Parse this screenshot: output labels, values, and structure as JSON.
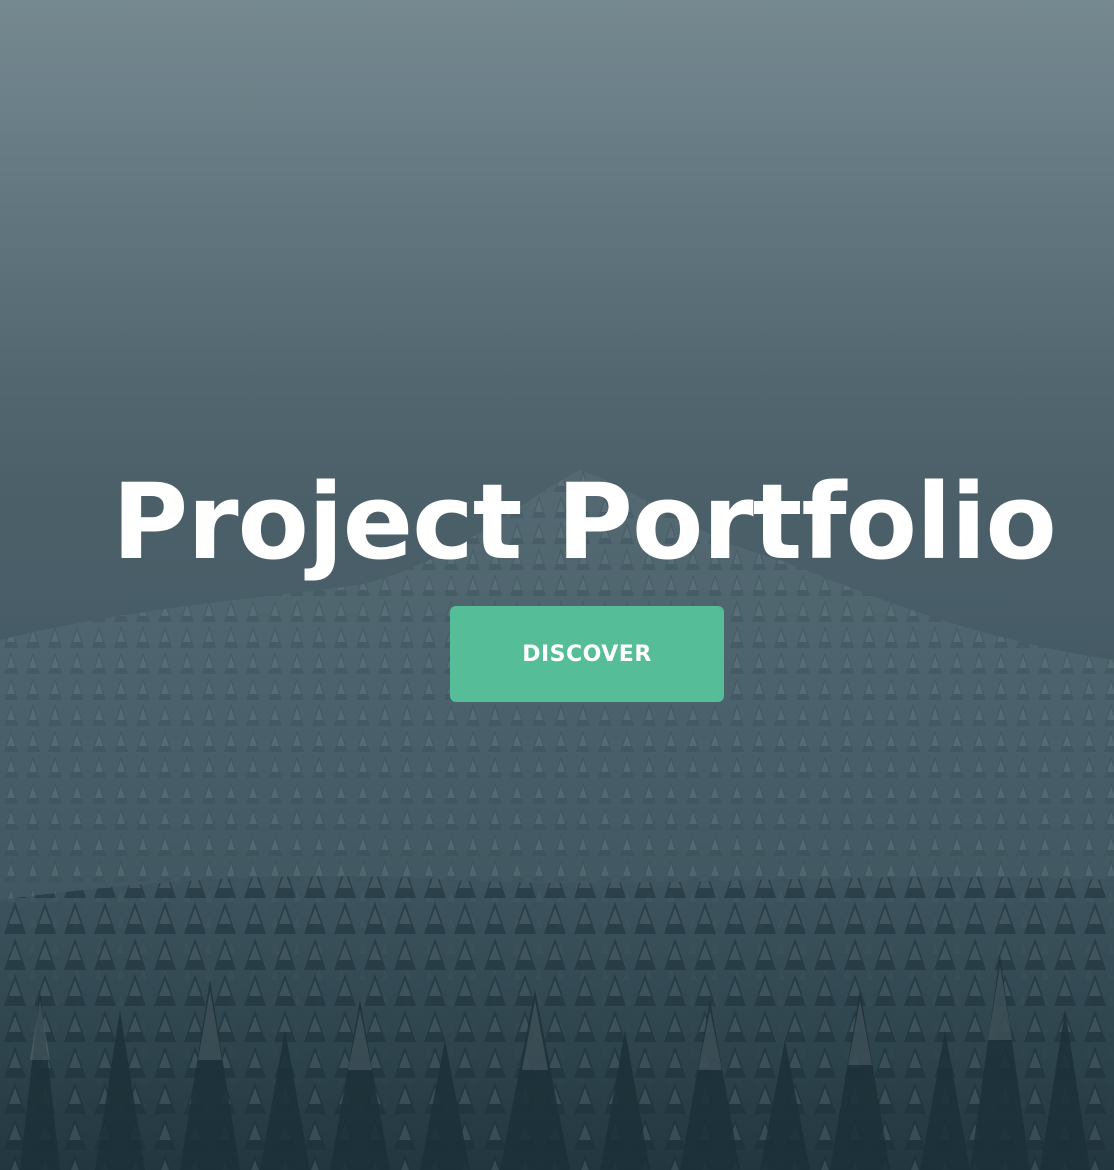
{
  "hero": {
    "title": "Project Portfolio",
    "button_label": "DISCOVER",
    "accent_color": "#55bd97",
    "background_image": "foggy-snowy-pine-forest"
  }
}
